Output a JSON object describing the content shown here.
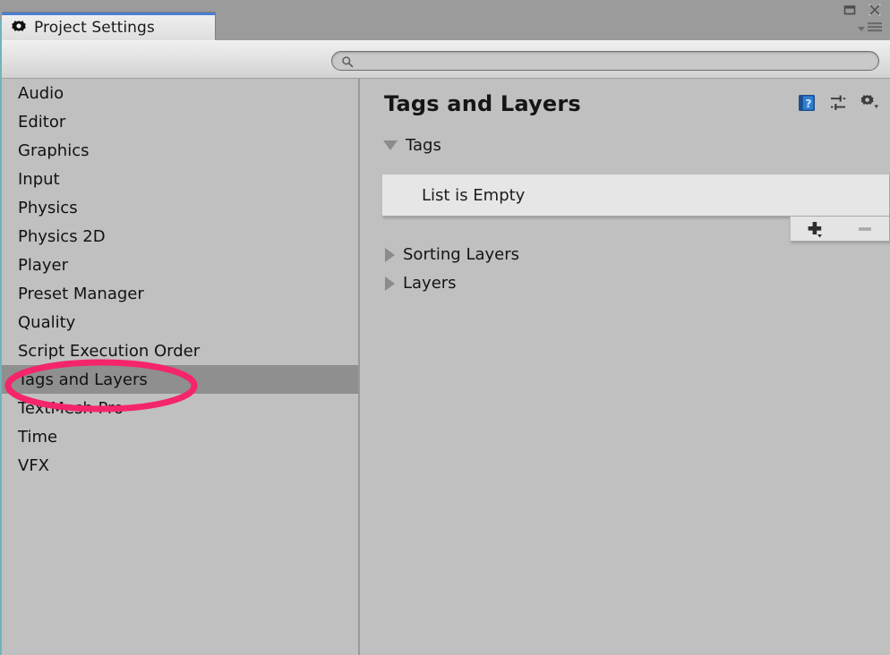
{
  "window": {
    "tab_label": "Project Settings",
    "tab_icon": "gear-icon",
    "restore_icon": "restore-window-icon",
    "close_icon": "close-window-icon",
    "menu_icon": "hamburger-menu-icon",
    "accent_tab_color": "#4a7fd4",
    "frame_border_color": "#6fb5b8",
    "background_color": "#c0c0c0"
  },
  "search": {
    "icon": "search-icon",
    "value": "",
    "placeholder": ""
  },
  "sidebar": {
    "items": [
      {
        "label": "Audio",
        "selected": false
      },
      {
        "label": "Editor",
        "selected": false
      },
      {
        "label": "Graphics",
        "selected": false
      },
      {
        "label": "Input",
        "selected": false
      },
      {
        "label": "Physics",
        "selected": false
      },
      {
        "label": "Physics 2D",
        "selected": false
      },
      {
        "label": "Player",
        "selected": false
      },
      {
        "label": "Preset Manager",
        "selected": false
      },
      {
        "label": "Quality",
        "selected": false
      },
      {
        "label": "Script Execution Order",
        "selected": false
      },
      {
        "label": "Tags and Layers",
        "selected": true
      },
      {
        "label": "TextMesh Pro",
        "selected": false
      },
      {
        "label": "Time",
        "selected": false
      },
      {
        "label": "VFX",
        "selected": false
      }
    ],
    "selected_highlight_color": "#8f8f8f"
  },
  "content": {
    "title": "Tags and Layers",
    "header_icons": [
      {
        "name": "help-book-icon",
        "tooltip": "Help"
      },
      {
        "name": "preset-sliders-icon",
        "tooltip": "Preset"
      },
      {
        "name": "settings-gear-icon",
        "tooltip": "Settings"
      }
    ],
    "sections": [
      {
        "label": "Tags",
        "expanded": true
      },
      {
        "label": "Sorting Layers",
        "expanded": false
      },
      {
        "label": "Layers",
        "expanded": false
      }
    ],
    "tags_list": {
      "empty_message": "List is Empty",
      "items": [],
      "add_button_label": "+",
      "remove_button_label": "−",
      "remove_button_disabled": true
    }
  },
  "annotation": {
    "shape": "ellipse",
    "color": "#f5256b",
    "target": "Tags and Layers"
  }
}
